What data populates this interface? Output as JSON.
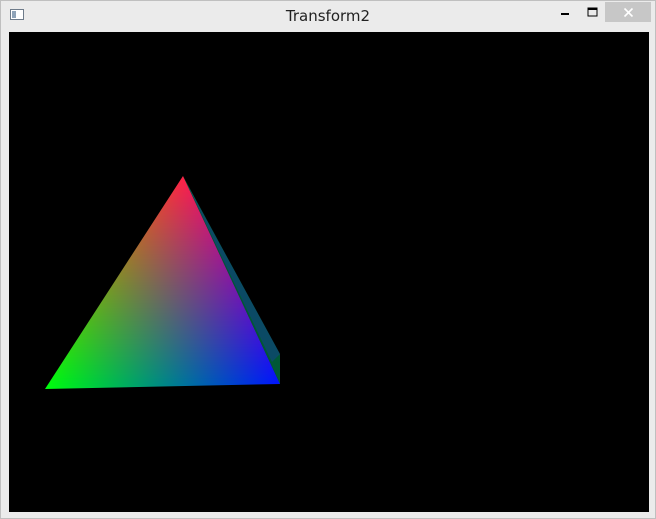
{
  "window": {
    "title": "Transform2",
    "controls": {
      "minimize_icon": "minimize-icon",
      "maximize_icon": "maximize-icon",
      "close_icon": "close-icon"
    }
  },
  "scene": {
    "background": "#000000",
    "vertex_colors": {
      "top": "#ff0000",
      "left": "#00ff00",
      "right": "#0000ff"
    }
  }
}
